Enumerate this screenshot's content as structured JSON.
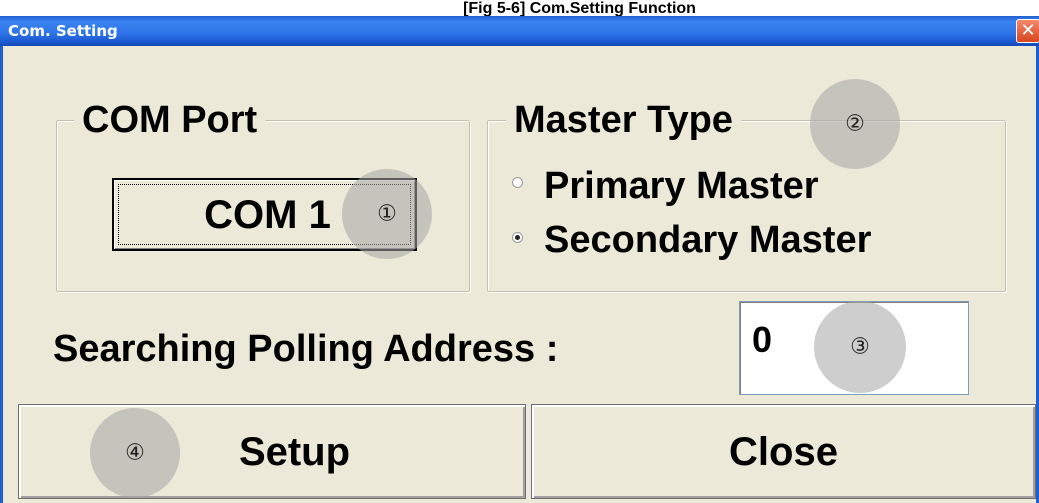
{
  "caption": "[Fig 5-6] Com.Setting Function",
  "window": {
    "title": "Com. Setting",
    "close_glyph": "✕"
  },
  "com_port": {
    "group_label": "COM Port",
    "button_label": "COM 1"
  },
  "master_type": {
    "group_label": "Master Type",
    "options": [
      {
        "label": "Primary Master",
        "selected": false
      },
      {
        "label": "Secondary Master",
        "selected": true
      }
    ]
  },
  "polling": {
    "label": "Searching Polling Address :",
    "value": "0"
  },
  "buttons": {
    "setup": "Setup",
    "close": "Close"
  },
  "markers": [
    "①",
    "②",
    "③",
    "④"
  ],
  "colors": {
    "titlebar": "#2f76ea",
    "dialog_bg": "#ece9d8",
    "close_button": "#d7461f"
  }
}
